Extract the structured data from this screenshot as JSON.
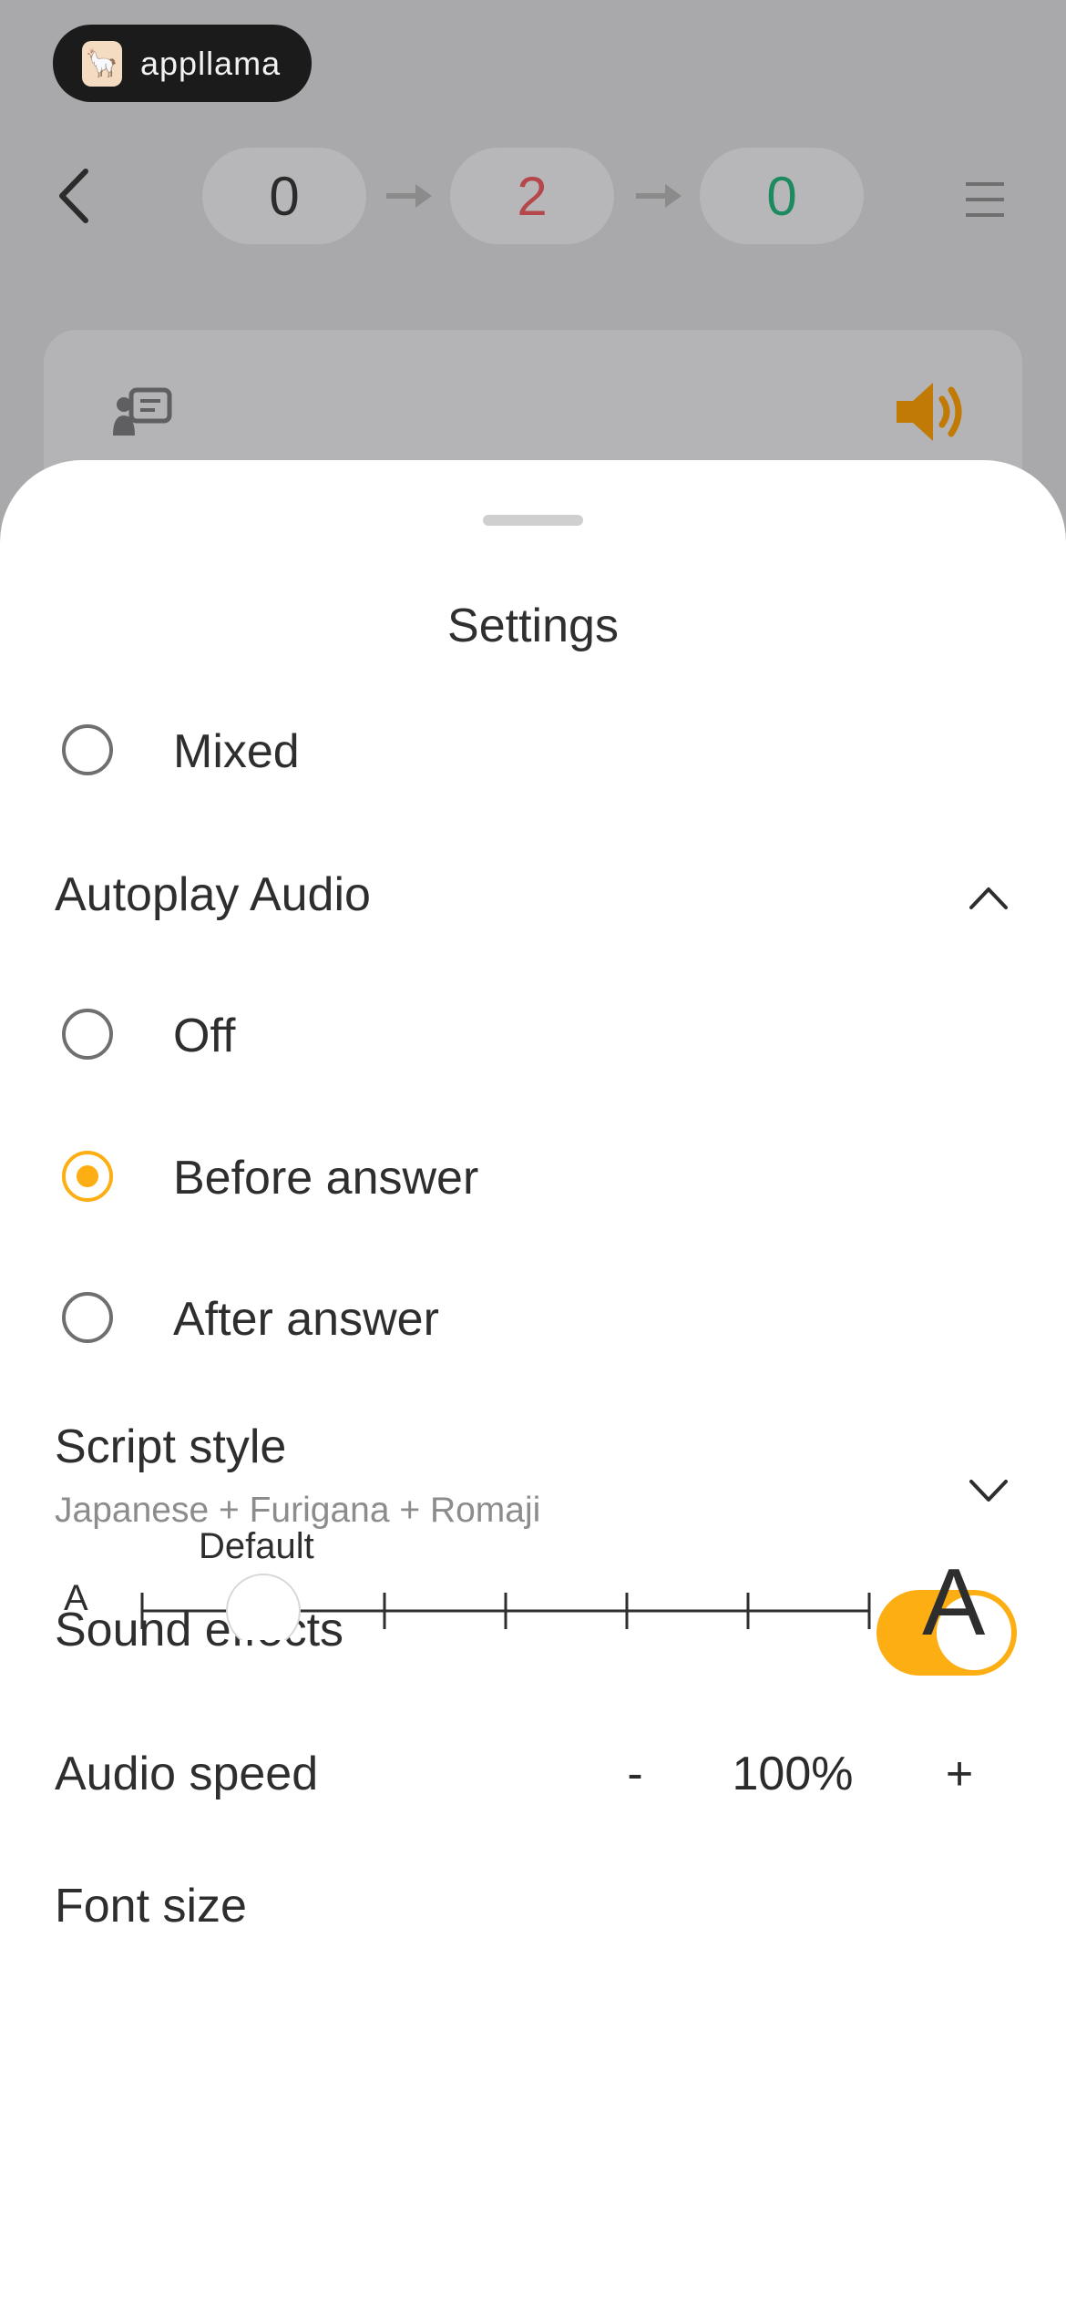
{
  "app": {
    "logo_text": "appllama"
  },
  "top_bar": {
    "counters": [
      {
        "value": "0",
        "color": "#2b2b2b"
      },
      {
        "value": "2",
        "color": "#b5474b"
      },
      {
        "value": "0",
        "color": "#1d8a5f"
      }
    ]
  },
  "settings": {
    "title": "Settings",
    "review_mode_option": {
      "label": "Mixed",
      "selected": false
    },
    "autoplay_audio": {
      "label": "Autoplay Audio",
      "expanded": true,
      "options": [
        {
          "label": "Off",
          "selected": false
        },
        {
          "label": "Before answer",
          "selected": true
        },
        {
          "label": "After answer",
          "selected": false
        }
      ]
    },
    "script_style": {
      "label": "Script style",
      "value": "Japanese + Furigana + Romaji"
    },
    "sound_effects": {
      "label": "Sound effects",
      "enabled": true
    },
    "audio_speed": {
      "label": "Audio speed",
      "minus": "-",
      "value": "100%",
      "plus": "+"
    },
    "font_size": {
      "label": "Font size",
      "small_glyph": "A",
      "large_glyph": "A",
      "default_label": "Default",
      "steps": 7,
      "selected_step": 1
    }
  },
  "colors": {
    "accent": "#fdae12",
    "overlay": "#a9a9ab"
  }
}
